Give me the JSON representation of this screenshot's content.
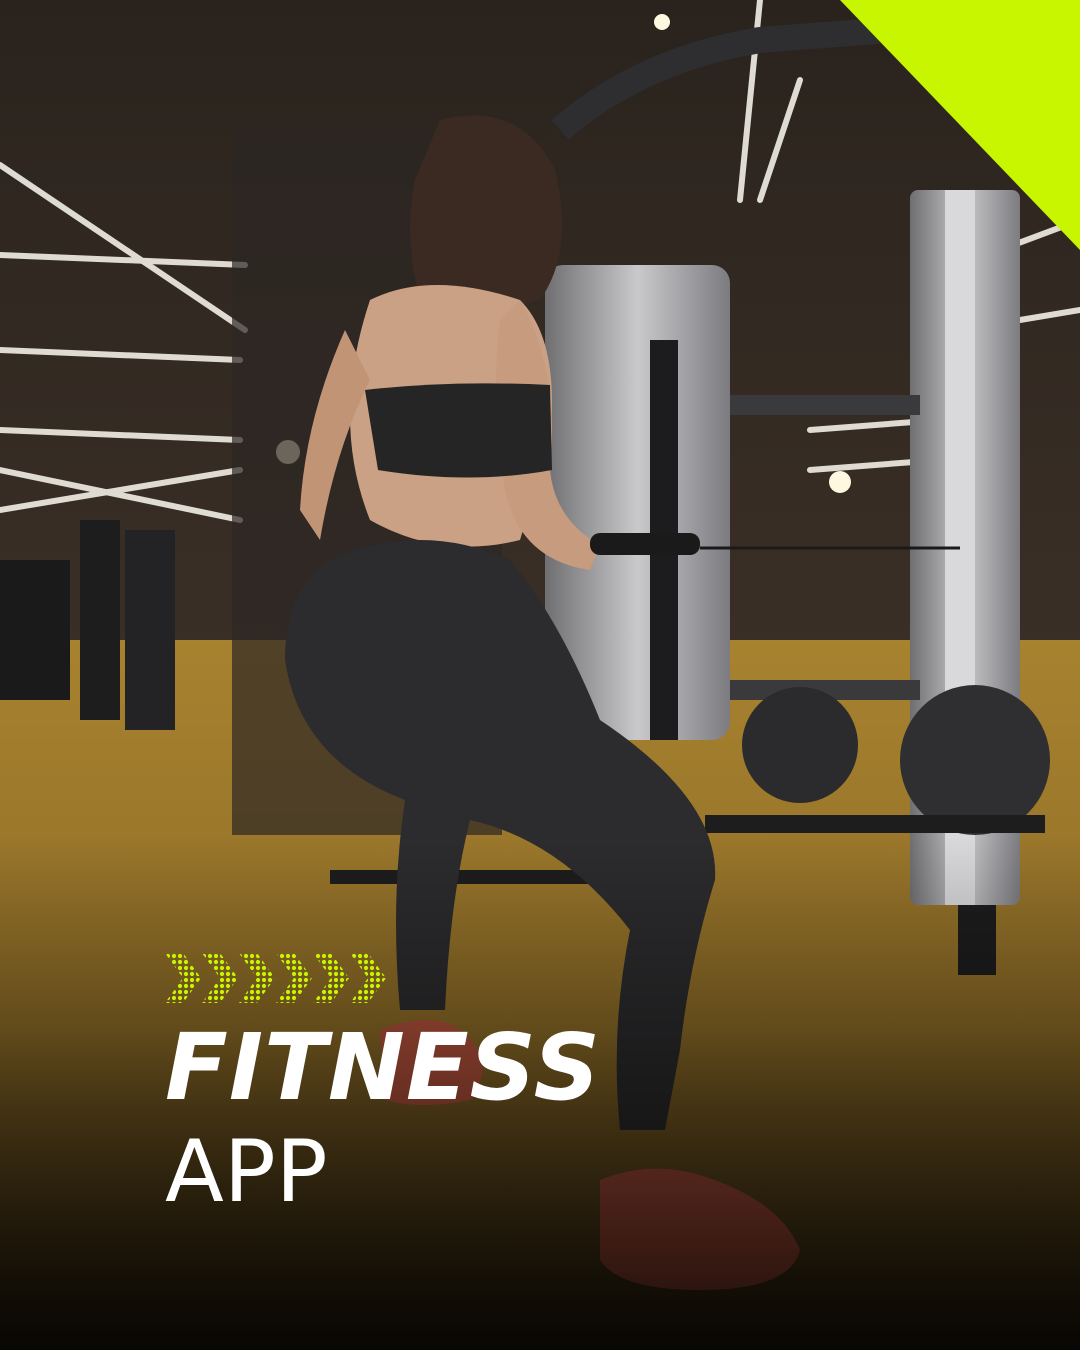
{
  "headline": {
    "title": "FITNESS",
    "subtitle": "APP"
  },
  "decoration": {
    "accent_color": "#c8f500",
    "chevron_icon": "dotted-chevron-arrows-icon",
    "corner_shape": "corner-triangle"
  },
  "photo": {
    "subject": "woman-doing-cable-exercise-in-gym"
  }
}
